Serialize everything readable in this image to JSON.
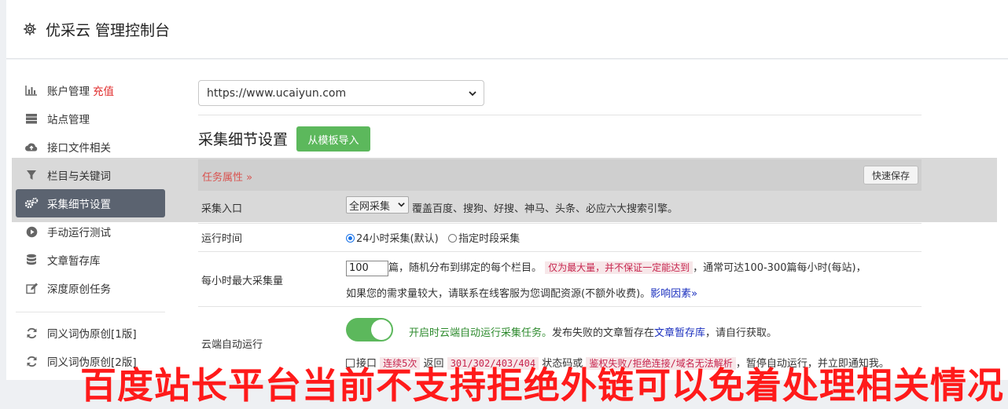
{
  "header": {
    "title": "优采云 管理控制台",
    "icon": "gear-icon"
  },
  "sidebar": {
    "items": [
      {
        "label": "账户管理",
        "icon": "bar-chart-icon",
        "extra": "充值"
      },
      {
        "label": "站点管理",
        "icon": "server-icon"
      },
      {
        "label": "接口文件相关",
        "icon": "cloud-upload-icon"
      },
      {
        "label": "栏目与关键词",
        "icon": "filter-icon"
      },
      {
        "label": "采集细节设置",
        "icon": "gears-icon",
        "active": true
      },
      {
        "label": "手动运行测试",
        "icon": "play-circle-icon"
      },
      {
        "label": "文章暂存库",
        "icon": "database-icon"
      },
      {
        "label": "深度原创任务",
        "icon": "edit-icon"
      },
      {
        "label": "同义词伪原创[1版]",
        "icon": "refresh-icon"
      },
      {
        "label": "同义词伪原创[2版]",
        "icon": "refresh-icon"
      }
    ]
  },
  "site_select": {
    "value": "https://www.ucaiyun.com"
  },
  "section": {
    "title": "采集细节设置",
    "import_button": "从模板导入"
  },
  "tab": {
    "label": "任务属性 »",
    "save_button": "快速保存"
  },
  "rows": {
    "entry": {
      "label": "采集入口",
      "select_value": "全网采集",
      "desc": "覆盖百度、搜狗、好搜、神马、头条、必应六大搜索引擎。"
    },
    "run_time": {
      "label": "运行时间",
      "option1": "24小时采集(默认)",
      "option2": "指定时段采集"
    },
    "max_per_hour": {
      "label": "每小时最大采集量",
      "value": "100",
      "text1": "篇，随机分布到绑定的每个栏目。",
      "tag": "仅为最大量，并不保证一定能达到",
      "text2": "，通常可达100-300篇每小时(每站)，",
      "text3": "如果您的需求量较大，请联系在线客服为您调配资源(不额外收费)。",
      "link": "影响因素»"
    },
    "cloud_run": {
      "label": "云端自动运行",
      "toggle_text": "开启时云端自动运行采集任务。",
      "text1": "发布失败的文章暂存在",
      "link": "文章暂存库",
      "text2": "，请自行获取。",
      "line2_a": "接口",
      "line2_tag1": "连续5次",
      "line2_b": "返回",
      "line2_tag2": "301/302/403/404",
      "line2_c": "状态码或",
      "line2_tag3": "鉴权失败/拒绝连接/域名无法解析",
      "line2_d": "，暂停自动运行，并立即通知我。"
    }
  },
  "watermark": "百度站长平台当前不支持拒绝外链可以免着处理相关情况",
  "colors": {
    "accent_green": "#5cb85c",
    "active_sidebar": "#5b6370",
    "red": "#e02b2b"
  }
}
